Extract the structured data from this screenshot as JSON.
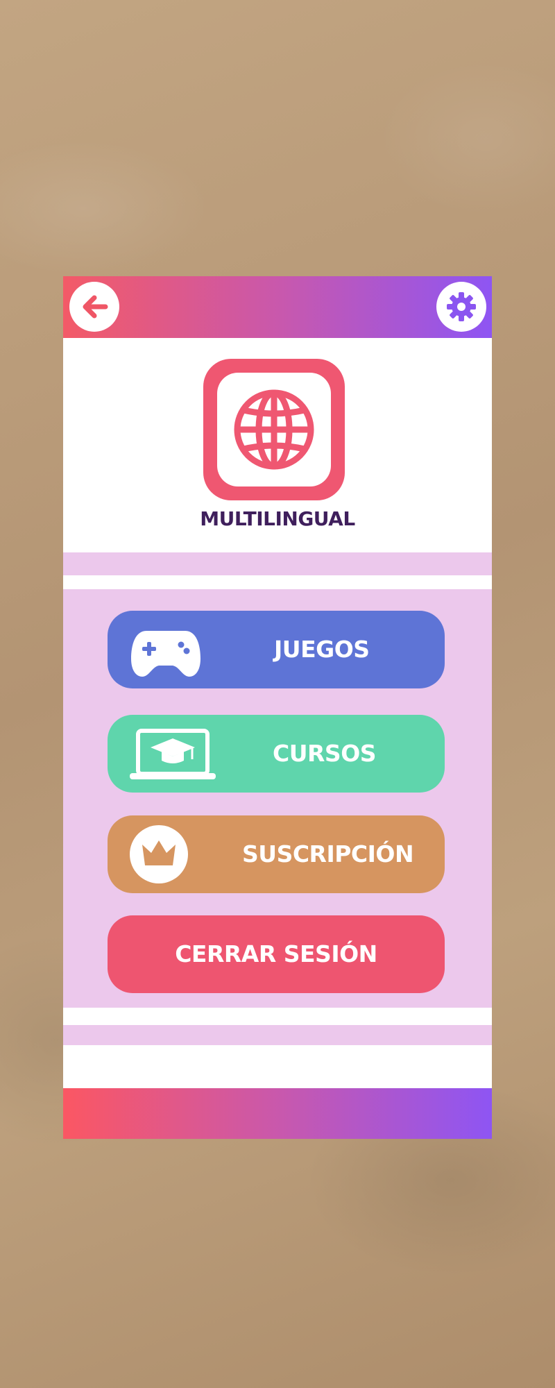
{
  "app": {
    "title": "MULTILINGUAL",
    "logo_icon": "globe-icon"
  },
  "header": {
    "back_icon": "arrow-left-icon",
    "settings_icon": "gear-icon"
  },
  "menu": {
    "items": [
      {
        "label": "JUEGOS",
        "icon": "gamepad-icon",
        "color": "#5e74d6"
      },
      {
        "label": "CURSOS",
        "icon": "laptop-graduation-cap-icon",
        "color": "#5fd5ac"
      },
      {
        "label": "SUSCRIPCIÓN",
        "icon": "crown-icon",
        "color": "#d69560"
      },
      {
        "label": "CERRAR SESIÓN",
        "icon": "",
        "color": "#ee5570"
      }
    ]
  },
  "colors": {
    "gradient_start": "#f35a67",
    "gradient_mid": "#c958ac",
    "gradient_end": "#8e55f3",
    "band": "#ecc8ec",
    "title_text": "#3f1f5c"
  }
}
